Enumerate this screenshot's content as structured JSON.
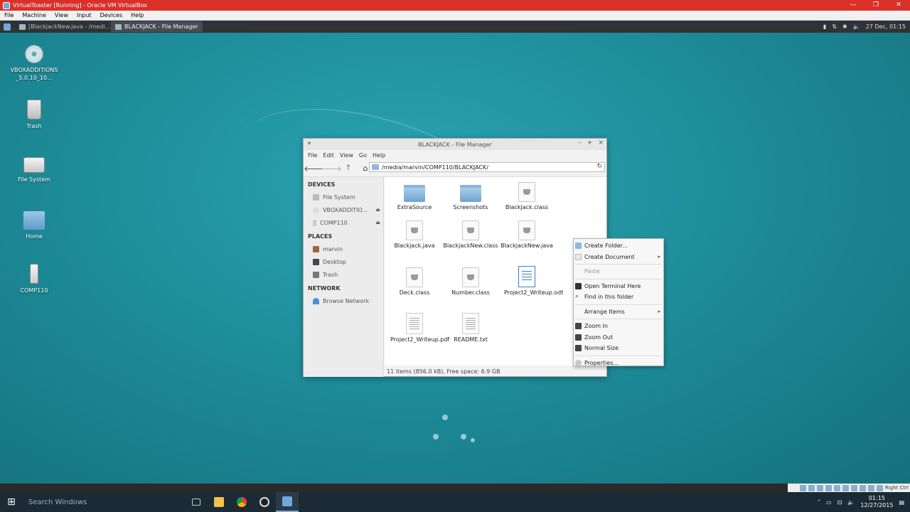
{
  "vbox": {
    "title": "VirtualToaster [Running] - Oracle VM VirtualBox",
    "minimize": "—",
    "maximize": "❐",
    "close": "✕",
    "menu": [
      "File",
      "Machine",
      "View",
      "Input",
      "Devices",
      "Help"
    ],
    "status_hostkey": "Right Ctrl"
  },
  "xfce_panel": {
    "tasks": [
      {
        "label": "[BlackjackNew.java - /medi...",
        "active": false
      },
      {
        "label": "BLACKJACK - File Manager",
        "active": true
      }
    ],
    "clock": "27 Dec, 01:15"
  },
  "desktop_icons": [
    {
      "label": "VBOXADDITIONS_5.0.10_10...",
      "icon": "cd-icon"
    },
    {
      "label": "Trash",
      "icon": "trash-icon"
    },
    {
      "label": "File System",
      "icon": "drive-icon"
    },
    {
      "label": "Home",
      "icon": "home-folder-icon"
    },
    {
      "label": "COMP110",
      "icon": "usb-drive-icon"
    }
  ],
  "file_manager": {
    "title": "BLACKJACK - File Manager",
    "menu": [
      "File",
      "Edit",
      "View",
      "Go",
      "Help"
    ],
    "location": "/media/marvin/COMP110/BLACKJACK/",
    "sidebar": {
      "devices_header": "DEVICES",
      "devices": [
        "File System",
        "VBOXADDITIO...",
        "COMP110"
      ],
      "places_header": "PLACES",
      "places": [
        "marvin",
        "Desktop",
        "Trash"
      ],
      "network_header": "NETWORK",
      "network": [
        "Browse Network"
      ]
    },
    "files": [
      {
        "name": "ExtraSource",
        "type": "folder"
      },
      {
        "name": "Screenshots",
        "type": "folder"
      },
      {
        "name": "Blackjack.class",
        "type": "class"
      },
      {
        "name": "Blackjack.java",
        "type": "class"
      },
      {
        "name": "BlackjackNew.class",
        "type": "class"
      },
      {
        "name": "BlackjackNew.java",
        "type": "class"
      },
      {
        "name": "Deck.class",
        "type": "class"
      },
      {
        "name": "Number.class",
        "type": "class"
      },
      {
        "name": "Project2_Writeup.odt",
        "type": "odt"
      },
      {
        "name": "Project2_Writeup.pdf",
        "type": "pdf"
      },
      {
        "name": "README.txt",
        "type": "txt"
      }
    ],
    "status": "11 items (856.0 kB), Free space: 6.9 GB"
  },
  "context_menu": {
    "create_folder": "Create Folder...",
    "create_document": "Create Document",
    "paste": "Paste",
    "open_terminal": "Open Terminal Here",
    "find_in_folder": "Find in this folder",
    "arrange_items": "Arrange Items",
    "zoom_in": "Zoom In",
    "zoom_out": "Zoom Out",
    "normal_size": "Normal Size",
    "properties": "Properties..."
  },
  "windows_taskbar": {
    "search_placeholder": "Search Windows",
    "time": "01:15",
    "date": "12/27/2015"
  }
}
